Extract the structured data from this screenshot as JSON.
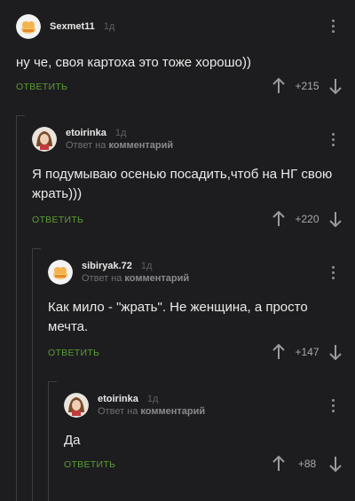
{
  "comments": [
    {
      "username": "Sexmet11",
      "time": "1д",
      "reply_to": null,
      "text": "ну че, своя картоха это тоже хорошо))",
      "reply_label": "ОТВЕТИТЬ",
      "score": "+215",
      "avatar": "chicken-avatar"
    },
    {
      "username": "etoirinka",
      "time": "1д",
      "reply_to_prefix": "Ответ на",
      "reply_to_link": "комментарий",
      "text": "Я подумываю осенью посадить,чтоб на НГ свою жрать)))",
      "reply_label": "ОТВЕТИТЬ",
      "score": "+220",
      "avatar": "girl-avatar"
    },
    {
      "username": "sibiryak.72",
      "time": "1д",
      "reply_to_prefix": "Ответ на",
      "reply_to_link": "комментарий",
      "text": "Как мило - \"жрать\". Не женщина, а просто мечта.",
      "reply_label": "ОТВЕТИТЬ",
      "score": "+147",
      "avatar": "chicken-avatar"
    },
    {
      "username": "etoirinka",
      "time": "1д",
      "reply_to_prefix": "Ответ на",
      "reply_to_link": "комментарий",
      "text": "Да",
      "reply_label": "ОТВЕТИТЬ",
      "score": "+88",
      "avatar": "girl-avatar"
    }
  ],
  "icons": {
    "upvote": "arrow-up-icon",
    "downvote": "arrow-down-icon",
    "more": "more-vertical-icon"
  },
  "colors": {
    "background": "#1d1d1f",
    "reply_green": "#5d9c35",
    "thread_line": "#3d3d40"
  }
}
